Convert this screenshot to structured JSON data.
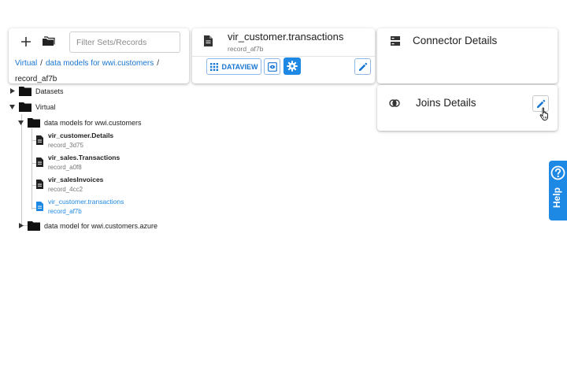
{
  "left_panel": {
    "filter_placeholder": "Filter Sets/Records",
    "breadcrumb": {
      "items": [
        "Virtual",
        "data models for wwi.customers"
      ],
      "separator": "/",
      "current": "record_af7b"
    }
  },
  "record_card": {
    "title": "vir_customer.transactions",
    "subtitle": "record_af7b",
    "dataview_label": "DATAVIEW"
  },
  "connector_card": {
    "title": "Connector Details"
  },
  "joins_card": {
    "title": "Joins Details"
  },
  "tree": {
    "datasets": "Datasets",
    "virtual": "Virtual",
    "models_folder": "data models for wwi.customers",
    "records": [
      {
        "title": "vir_customer.Details",
        "id": "record_3d75",
        "active": false
      },
      {
        "title": "vir_sales.Transactions",
        "id": "record_a0f8",
        "active": false
      },
      {
        "title": "vir_salesInvoices",
        "id": "record_4cc2",
        "active": false
      },
      {
        "title": "vir_customer.transactions",
        "id": "record_af7b",
        "active": true
      }
    ],
    "azure_folder": "data model for wwi.customers.azure"
  },
  "help": {
    "label": "Help"
  },
  "icons": {
    "add": "plus-icon",
    "folder": "folder-icon",
    "document": "document-icon",
    "grid": "grid-icon",
    "preview": "preview-icon",
    "settings": "gear-icon",
    "edit": "pencil-icon",
    "connector": "server-icon",
    "joins": "joins-icon",
    "help": "help-circle-icon",
    "cursor": "hand-pointer-icon"
  },
  "colors": {
    "accent": "#1e88e5",
    "link": "#1976d2",
    "active_record": "#1e88e5"
  }
}
